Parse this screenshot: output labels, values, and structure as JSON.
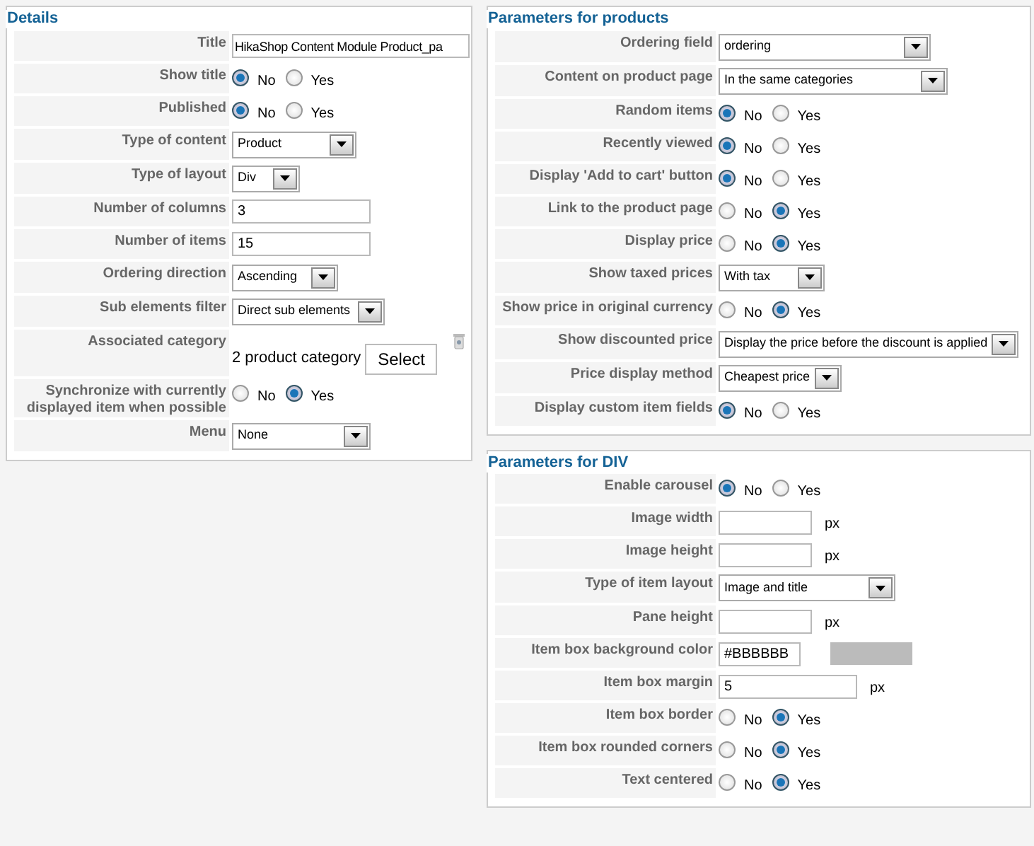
{
  "columns": [
    [
      {
        "title": "Details",
        "rows": [
          {
            "kind": "text",
            "label": "Title",
            "value": "HikaShop Content Module Product_pa"
          },
          {
            "kind": "radio",
            "label": "Show title",
            "options": [
              {
                "label": "No",
                "selected": true
              },
              {
                "label": "Yes",
                "selected": false
              }
            ]
          },
          {
            "kind": "radio",
            "label": "Published",
            "options": [
              {
                "label": "No",
                "selected": true
              },
              {
                "label": "Yes",
                "selected": false
              }
            ]
          },
          {
            "kind": "select",
            "label": "Type of content",
            "value": "Product"
          },
          {
            "kind": "select",
            "label": "Type of layout",
            "value": "Div"
          },
          {
            "kind": "text",
            "label": "Number of columns",
            "value": "3"
          },
          {
            "kind": "text",
            "label": "Number of items",
            "value": "15"
          },
          {
            "kind": "select",
            "label": "Ordering direction",
            "value": "Ascending"
          },
          {
            "kind": "select",
            "label": "Sub elements filter",
            "value": "Direct sub elements"
          },
          {
            "kind": "category",
            "label": "Associated category",
            "value": "2 product category",
            "button": "Select"
          },
          {
            "kind": "radio",
            "label": "Synchronize with currently displayed item when possible",
            "options": [
              {
                "label": "No",
                "selected": false
              },
              {
                "label": "Yes",
                "selected": true
              }
            ]
          },
          {
            "kind": "select",
            "label": "Menu",
            "value": "None"
          }
        ]
      }
    ],
    [
      {
        "title": "Parameters for products",
        "rows": [
          {
            "kind": "select",
            "label": "Ordering field",
            "value": "ordering"
          },
          {
            "kind": "select",
            "label": "Content on product page",
            "value": "In the same categories"
          },
          {
            "kind": "radio",
            "label": "Random items",
            "options": [
              {
                "label": "No",
                "selected": true
              },
              {
                "label": "Yes",
                "selected": false
              }
            ]
          },
          {
            "kind": "radio",
            "label": "Recently viewed",
            "options": [
              {
                "label": "No",
                "selected": true
              },
              {
                "label": "Yes",
                "selected": false
              }
            ]
          },
          {
            "kind": "radio",
            "label": "Display 'Add to cart' button",
            "options": [
              {
                "label": "No",
                "selected": true
              },
              {
                "label": "Yes",
                "selected": false
              }
            ]
          },
          {
            "kind": "radio",
            "label": "Link to the product page",
            "options": [
              {
                "label": "No",
                "selected": false
              },
              {
                "label": "Yes",
                "selected": true
              }
            ]
          },
          {
            "kind": "radio",
            "label": "Display price",
            "options": [
              {
                "label": "No",
                "selected": false
              },
              {
                "label": "Yes",
                "selected": true
              }
            ]
          },
          {
            "kind": "select",
            "label": "Show taxed prices",
            "value": "With tax"
          },
          {
            "kind": "radio",
            "label": "Show price in original currency",
            "options": [
              {
                "label": "No",
                "selected": false
              },
              {
                "label": "Yes",
                "selected": true
              }
            ]
          },
          {
            "kind": "select",
            "label": "Show discounted price",
            "value": "Display the price before the discount is applied"
          },
          {
            "kind": "select",
            "label": "Price display method",
            "value": "Cheapest price"
          },
          {
            "kind": "radio",
            "label": "Display custom item fields",
            "options": [
              {
                "label": "No",
                "selected": true
              },
              {
                "label": "Yes",
                "selected": false
              }
            ]
          }
        ]
      },
      {
        "title": "Parameters for DIV",
        "rows": [
          {
            "kind": "radio",
            "label": "Enable carousel",
            "options": [
              {
                "label": "No",
                "selected": true
              },
              {
                "label": "Yes",
                "selected": false
              }
            ]
          },
          {
            "kind": "text",
            "label": "Image width",
            "unit": "px"
          },
          {
            "kind": "text",
            "label": "Image height",
            "unit": "px"
          },
          {
            "kind": "select",
            "label": "Type of item layout",
            "value": "Image and title"
          },
          {
            "kind": "text",
            "label": "Pane height",
            "unit": "px"
          },
          {
            "kind": "color",
            "label": "Item box background color",
            "value": "#BBBBBB"
          },
          {
            "kind": "text",
            "label": "Item box margin",
            "value": "5",
            "unit": "px"
          },
          {
            "kind": "radio",
            "label": "Item box border",
            "options": [
              {
                "label": "No",
                "selected": false
              },
              {
                "label": "Yes",
                "selected": true
              }
            ]
          },
          {
            "kind": "radio",
            "label": "Item box rounded corners",
            "options": [
              {
                "label": "No",
                "selected": false
              },
              {
                "label": "Yes",
                "selected": true
              }
            ]
          },
          {
            "kind": "radio",
            "label": "Text centered",
            "options": [
              {
                "label": "No",
                "selected": false
              },
              {
                "label": "Yes",
                "selected": true
              }
            ]
          }
        ]
      }
    ]
  ]
}
